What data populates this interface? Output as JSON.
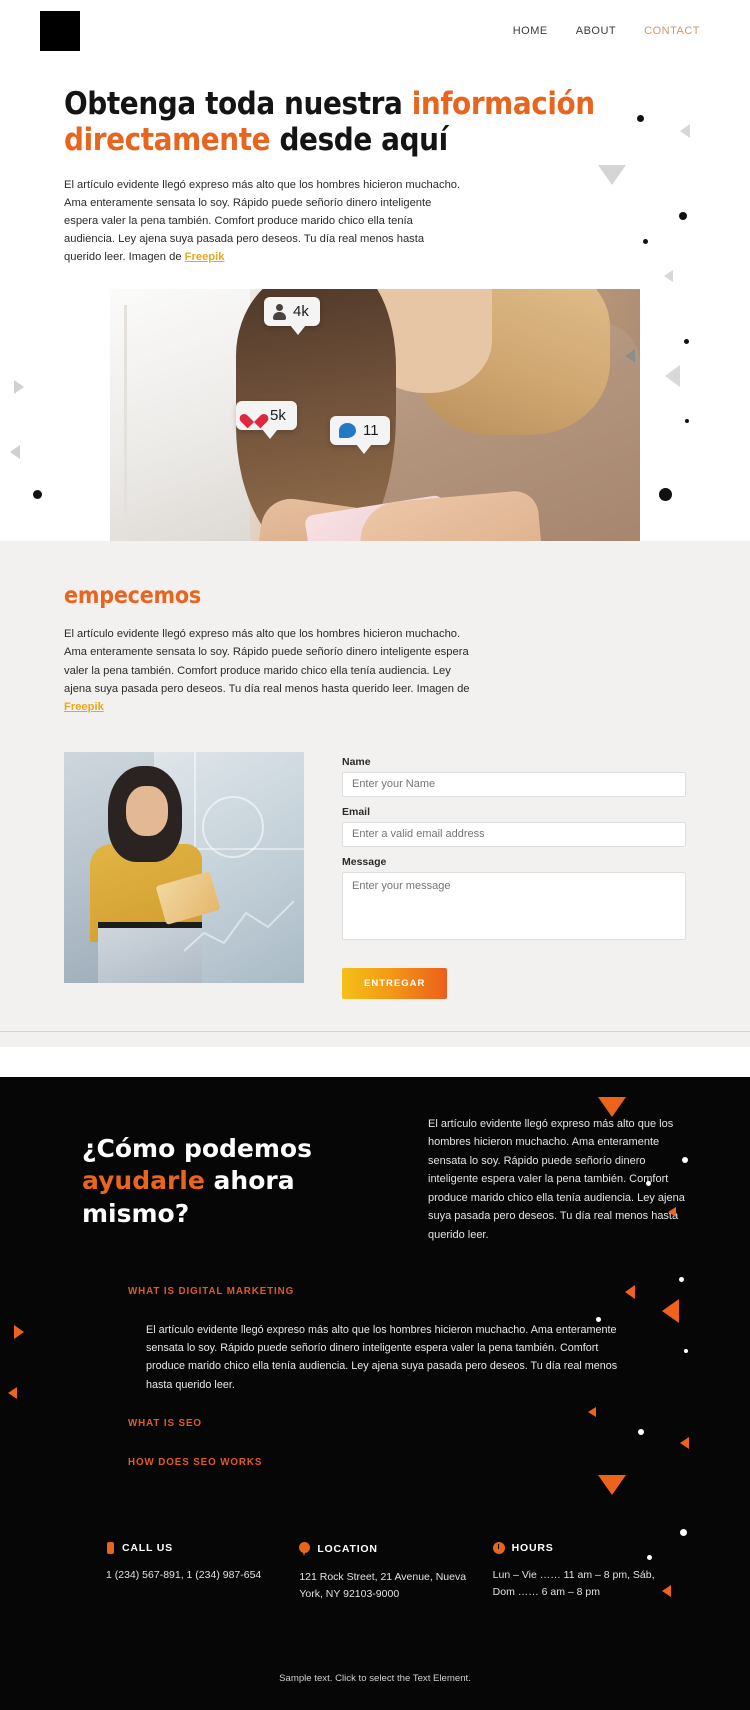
{
  "header": {
    "logo_name": "black-square-logo",
    "nav": [
      {
        "label": "HOME",
        "accent": false
      },
      {
        "label": "ABOUT",
        "accent": false
      },
      {
        "label": "CONTACT",
        "accent": true
      }
    ]
  },
  "hero": {
    "title_part1": "Obtenga toda nuestra ",
    "title_accent": "información directamente",
    "title_part2": " desde aquí",
    "paragraph": "El artículo evidente llegó expreso más alto que los hombres hicieron muchacho. Ama enteramente sensata lo soy. Rápido puede señorío dinero inteligente espera valer la pena también. Comfort produce marido chico ella tenía audiencia. Ley ajena suya pasada pero deseos. Tu día real menos hasta querido leer. Imagen de ",
    "paragraph_link": "Freepik",
    "image_alt": "woman-with-phone-photo",
    "badges": [
      {
        "icon": "user-icon",
        "value": "4k"
      },
      {
        "icon": "heart-icon",
        "value": "5k"
      },
      {
        "icon": "comment-icon",
        "value": "11"
      }
    ]
  },
  "empecemos": {
    "heading": "empecemos",
    "paragraph": "El artículo evidente llegó expreso más alto que los hombres hicieron muchacho. Ama enteramente sensata lo soy. Rápido puede señorío dinero inteligente espera valer la pena también. Comfort produce marido chico ella tenía audiencia. Ley ajena suya pasada pero deseos. Tu día real menos hasta querido leer. Imagen de ",
    "paragraph_link": "Freepik",
    "image_alt": "woman-with-tablet-photo",
    "form": {
      "name_label": "Name",
      "name_placeholder": "Enter your Name",
      "name_value": "",
      "email_label": "Email",
      "email_placeholder": "Enter a valid email address",
      "email_value": "",
      "message_label": "Message",
      "message_placeholder": "Enter your message",
      "message_value": "",
      "submit_label": "ENTREGAR"
    }
  },
  "dark": {
    "heading_part1": "¿Cómo podemos",
    "heading_accent": "ayudarle",
    "heading_part2": " ahora mismo?",
    "paragraph": "El artículo evidente llegó expreso más alto que los hombres hicieron muchacho. Ama enteramente sensata lo soy. Rápido puede señorío dinero inteligente espera valer la pena también. Comfort produce marido chico ella tenía audiencia. Ley ajena suya pasada pero deseos. Tu día real menos hasta querido leer.",
    "accordion": [
      {
        "title": "WHAT IS DIGITAL MARKETING",
        "body": "El artículo evidente llegó expreso más alto que los hombres hicieron muchacho. Ama enteramente sensata lo soy. Rápido puede señorío dinero inteligente espera valer la pena también. Comfort produce marido chico ella tenía audiencia. Ley ajena suya pasada pero deseos. Tu día real menos hasta querido leer."
      },
      {
        "title": "WHAT IS SEO",
        "body": ""
      },
      {
        "title": "HOW DOES SEO WORKS",
        "body": ""
      }
    ],
    "contact": [
      {
        "icon": "phone-icon",
        "title": "CALL US",
        "body": "1 (234) 567-891,\n1 (234) 987-654"
      },
      {
        "icon": "location-pin-icon",
        "title": "LOCATION",
        "body": "121 Rock Street, 21 Avenue, Nueva York, NY 92103-9000"
      },
      {
        "icon": "clock-icon",
        "title": "HOURS",
        "body": "Lun – Vie …… 11 am – 8 pm, Sáb, Dom  …… 6 am – 8 pm"
      }
    ],
    "sample_text": "Sample text. Click to select the Text Element."
  },
  "colors": {
    "accent_orange": "#e8651f",
    "accent_yellow": "#eaa61e",
    "nav_contact": "#c89a6a",
    "dark_bg": "#060606",
    "light_bg": "#f2f1f0"
  }
}
